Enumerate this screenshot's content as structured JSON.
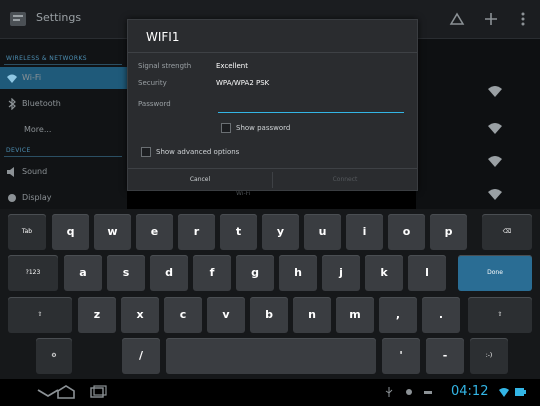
{
  "action_bar": {
    "title": "Settings"
  },
  "sidebar": {
    "sections": [
      "WIRELESS & NETWORKS",
      "DEVICE"
    ],
    "items": [
      {
        "label": "Wi-Fi",
        "selected": true
      },
      {
        "label": "Bluetooth"
      },
      {
        "label": "More..."
      },
      {
        "label": "Sound"
      },
      {
        "label": "Display"
      }
    ]
  },
  "dialog": {
    "title": "WIFI1",
    "rows": [
      {
        "label": "Signal strength",
        "value": "Excellent"
      },
      {
        "label": "Security",
        "value": "WPA/WPA2 PSK"
      }
    ],
    "password_label": "Password",
    "password_value": "",
    "show_password_label": "Show password",
    "advanced_label": "Show advanced options",
    "cancel_label": "Cancel",
    "connect_label": "Connect"
  },
  "behind_text": "Wi-Fi",
  "keyboard": {
    "row1": [
      "Tab",
      "q",
      "w",
      "e",
      "r",
      "t",
      "y",
      "u",
      "i",
      "o",
      "p",
      "⌫"
    ],
    "row2": [
      "?123",
      "a",
      "s",
      "d",
      "f",
      "g",
      "h",
      "j",
      "k",
      "l",
      "Done"
    ],
    "row3": [
      "⇧",
      "z",
      "x",
      "c",
      "v",
      "b",
      "n",
      "m",
      ",",
      ".",
      "⇧"
    ],
    "row4": [
      "⚙",
      "/",
      "",
      "'",
      "-",
      ":-)"
    ]
  },
  "status_bar": {
    "time": "04:12"
  },
  "colors": {
    "accent": "#33b5e5",
    "selected": "#1f5a7a",
    "done_key": "#2a6d94"
  }
}
